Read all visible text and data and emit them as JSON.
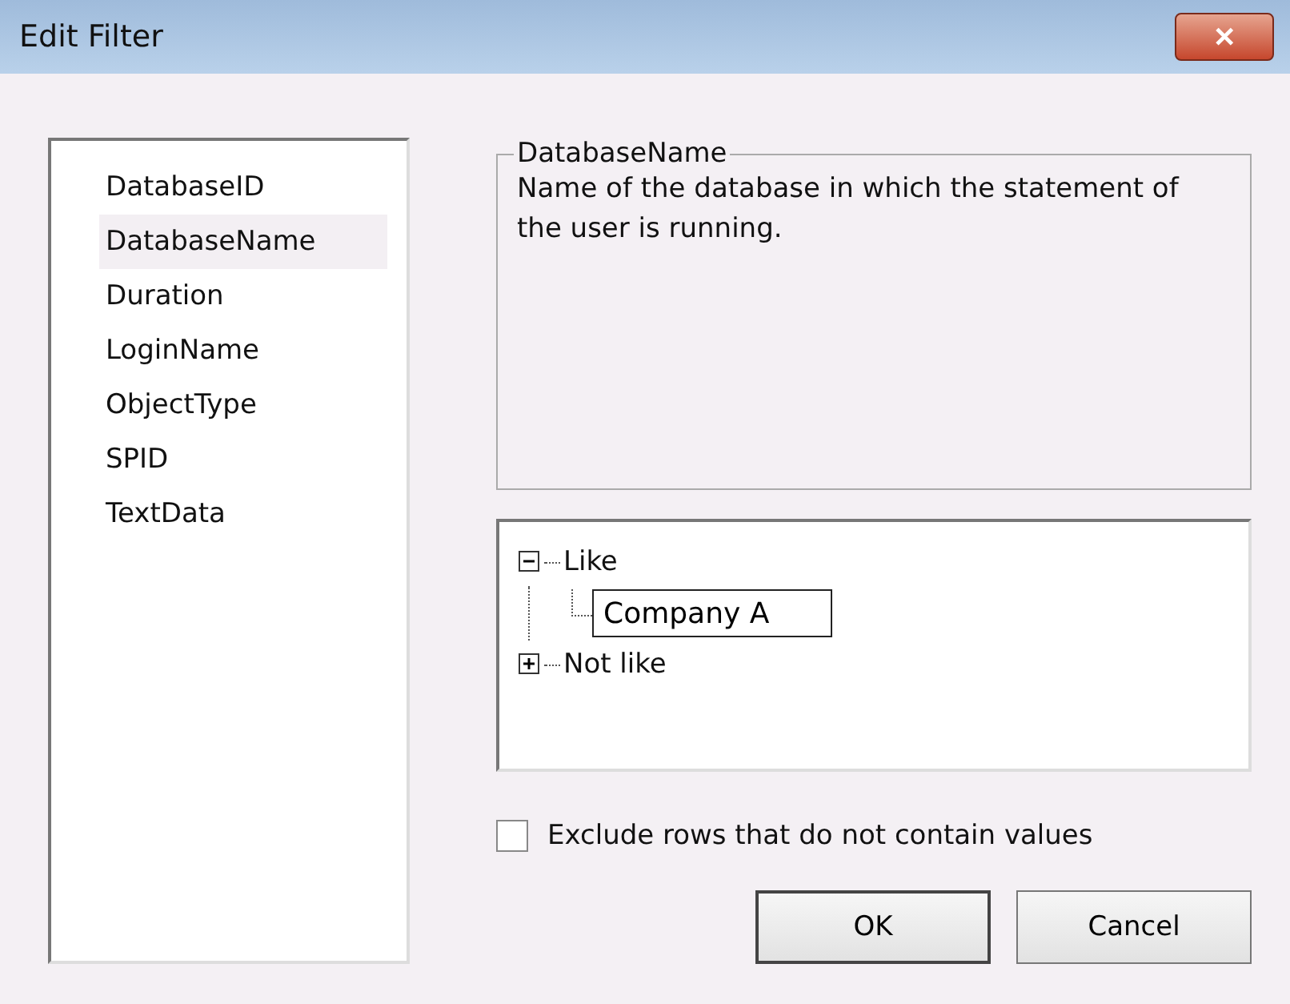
{
  "window": {
    "title": "Edit Filter",
    "close": "✕"
  },
  "columns": [
    {
      "label": "DatabaseID",
      "selected": false
    },
    {
      "label": "DatabaseName",
      "selected": true
    },
    {
      "label": "Duration",
      "selected": false
    },
    {
      "label": "LoginName",
      "selected": false
    },
    {
      "label": "ObjectType",
      "selected": false
    },
    {
      "label": "SPID",
      "selected": false
    },
    {
      "label": "TextData",
      "selected": false
    }
  ],
  "description": {
    "legend": "DatabaseName",
    "text": "Name of the database in which the statement of the user is running."
  },
  "tree": [
    {
      "label": "Like",
      "expanded": true,
      "children": [
        {
          "value": "Company A"
        }
      ]
    },
    {
      "label": "Not like",
      "expanded": false
    }
  ],
  "exclude": {
    "label": "Exclude rows that do not contain values",
    "checked": false
  },
  "buttons": [
    "OK",
    "Cancel"
  ]
}
